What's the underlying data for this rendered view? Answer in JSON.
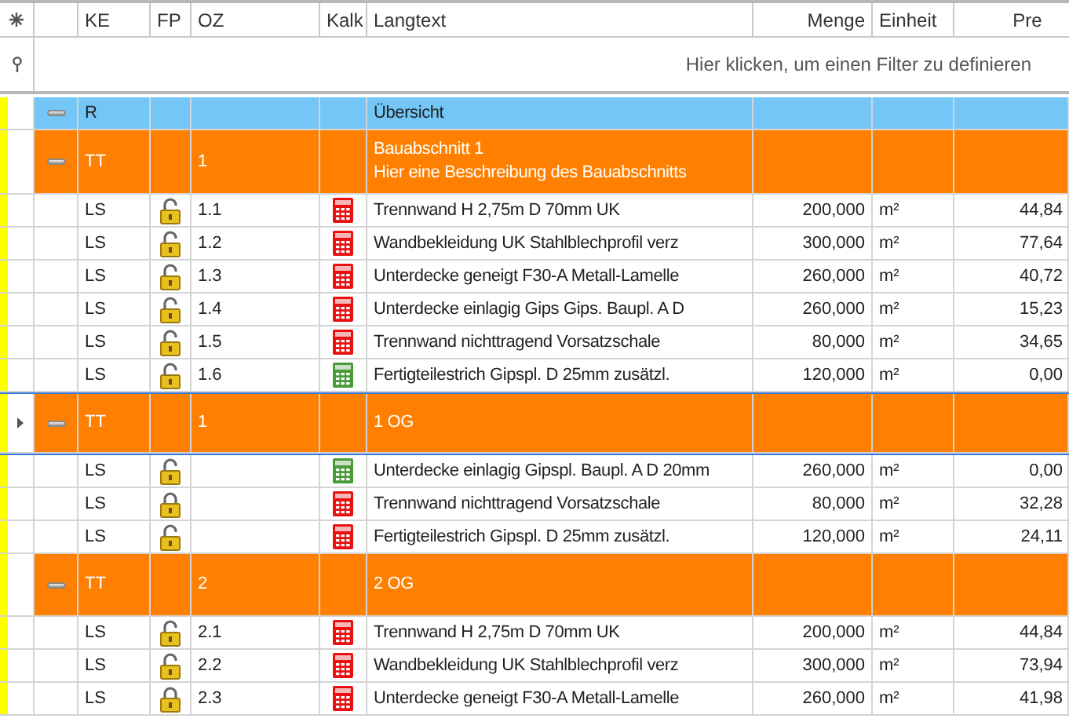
{
  "columns": [
    "KE",
    "FP",
    "OZ",
    "Kalk",
    "Langtext",
    "Menge",
    "Einheit",
    "Pre"
  ],
  "filter_row": {
    "placeholder": "Hier klicken, um einen Filter zu definieren"
  },
  "rows": [
    {
      "kind": "summary",
      "expanded": true,
      "selected": false,
      "ke": "R",
      "langtext": "Übersicht"
    },
    {
      "kind": "title",
      "expanded": true,
      "selected": false,
      "ke": "TT",
      "oz": "1",
      "langtext": "Bauabschnitt 1",
      "description": "Hier eine Beschreibung des Bauabschnitts"
    },
    {
      "kind": "item",
      "selected": false,
      "ke": "LS",
      "locked": false,
      "oz": "1.1",
      "color": "#e81010",
      "langtext": "Trennwand H 2,75m D 70mm UK",
      "menge": "200,000",
      "einheit": "m²",
      "preis": "44,84"
    },
    {
      "kind": "item",
      "selected": false,
      "ke": "LS",
      "locked": false,
      "oz": "1.2",
      "color": "#e81010",
      "langtext": "Wandbekleidung UK Stahlblechprofil verz",
      "menge": "300,000",
      "einheit": "m²",
      "preis": "77,64"
    },
    {
      "kind": "item",
      "selected": false,
      "ke": "LS",
      "locked": false,
      "oz": "1.3",
      "color": "#e81010",
      "langtext": "Unterdecke geneigt F30-A Metall-Lamelle",
      "menge": "260,000",
      "einheit": "m²",
      "preis": "40,72"
    },
    {
      "kind": "item",
      "selected": false,
      "ke": "LS",
      "locked": false,
      "oz": "1.4",
      "color": "#e81010",
      "langtext": "Unterdecke einlagig Gips Gips. Baupl. A D",
      "menge": "260,000",
      "einheit": "m²",
      "preis": "15,23"
    },
    {
      "kind": "item",
      "selected": false,
      "ke": "LS",
      "locked": false,
      "oz": "1.5",
      "color": "#e81010",
      "langtext": "Trennwand nichttragend Vorsatzschale",
      "menge": "80,000",
      "einheit": "m²",
      "preis": "34,65"
    },
    {
      "kind": "item",
      "selected": false,
      "ke": "LS",
      "locked": false,
      "oz": "1.6",
      "color": "#4a9a3a",
      "langtext": "Fertigteilestrich Gipspl. D 25mm zusätzl.",
      "menge": "120,000",
      "einheit": "m²",
      "preis": "0,00"
    },
    {
      "kind": "title",
      "expanded": true,
      "selected": true,
      "ke": "TT",
      "oz": "1",
      "langtext": "1 OG"
    },
    {
      "kind": "item",
      "selected": false,
      "ke": "LS",
      "locked": false,
      "color": "#4a9a3a",
      "langtext": "Unterdecke einlagig Gipspl. Baupl. A D 20mm",
      "menge": "260,000",
      "einheit": "m²",
      "preis": "0,00"
    },
    {
      "kind": "item",
      "selected": false,
      "ke": "LS",
      "locked": true,
      "color": "#e81010",
      "langtext": "Trennwand nichttragend Vorsatzschale",
      "menge": "80,000",
      "einheit": "m²",
      "preis": "32,28"
    },
    {
      "kind": "item",
      "selected": false,
      "ke": "LS",
      "locked": false,
      "color": "#e81010",
      "langtext": "Fertigteilestrich Gipspl. D 25mm zusätzl.",
      "menge": "120,000",
      "einheit": "m²",
      "preis": "24,11"
    },
    {
      "kind": "title",
      "expanded": true,
      "selected": false,
      "ke": "TT",
      "oz": "2",
      "langtext": "2 OG"
    },
    {
      "kind": "item",
      "selected": false,
      "ke": "LS",
      "locked": false,
      "oz": "2.1",
      "color": "#e81010",
      "langtext": "Trennwand H 2,75m D 70mm UK",
      "menge": "200,000",
      "einheit": "m²",
      "preis": "44,84"
    },
    {
      "kind": "item",
      "selected": false,
      "ke": "LS",
      "locked": false,
      "oz": "2.2",
      "color": "#e81010",
      "langtext": "Wandbekleidung UK Stahlblechprofil verz",
      "menge": "300,000",
      "einheit": "m²",
      "preis": "73,94"
    },
    {
      "kind": "item",
      "selected": false,
      "ke": "LS",
      "locked": true,
      "oz": "2.3",
      "color": "#e81010",
      "langtext": "Unterdecke geneigt F30-A Metall-Lamelle",
      "menge": "260,000",
      "einheit": "m²",
      "preis": "41,98"
    }
  ]
}
